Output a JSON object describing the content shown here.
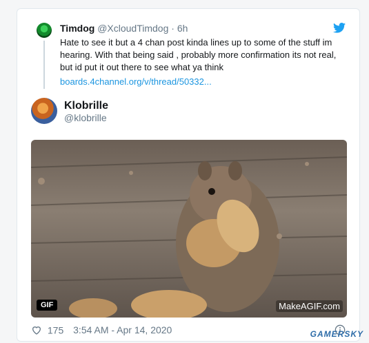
{
  "quoted": {
    "name": "Timdog",
    "handle": "@XcloudTimdog",
    "dot": "·",
    "time": "6h",
    "text": "Hate to see it but a 4 chan post kinda lines up to some of the stuff im hearing.   With that being said , probably more confirmation its not real, but id put it out there to see what ya think",
    "link": "boards.4channel.org/v/thread/50332..."
  },
  "tweet": {
    "name": "Klobrille",
    "handle": "@klobrille",
    "media_badge": "GIF",
    "media_watermark": "MakeAGIF.com",
    "likes": "175",
    "timestamp": "3:54 AM - Apr 14, 2020"
  },
  "site_watermark": "GAMERSKY",
  "colors": {
    "link": "#1b95e0",
    "twitter_blue": "#1da1f2",
    "muted": "#657786"
  },
  "icons": [
    "twitter-bird-icon",
    "heart-icon",
    "info-icon"
  ]
}
